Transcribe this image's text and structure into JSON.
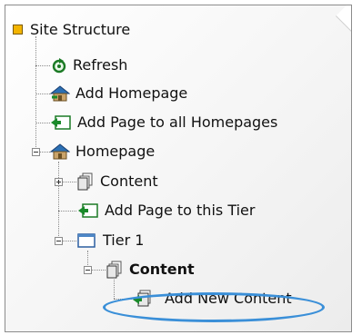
{
  "tree": {
    "root_label": "Site Structure",
    "items": [
      {
        "label": "Refresh",
        "icon": "refresh-icon"
      },
      {
        "label": "Add Homepage",
        "icon": "add-homepage-icon"
      },
      {
        "label": "Add Page to all Homepages",
        "icon": "add-page-icon"
      },
      {
        "label": "Homepage",
        "icon": "homepage-icon"
      },
      {
        "label": "Content",
        "icon": "content-pages-icon"
      },
      {
        "label": "Add Page to this Tier",
        "icon": "add-page-icon"
      },
      {
        "label": "Tier 1",
        "icon": "tier-icon"
      },
      {
        "label": "Content",
        "icon": "content-pages-icon"
      },
      {
        "label": "Add New Content",
        "icon": "add-content-icon"
      }
    ]
  },
  "colors": {
    "root_bullet": "#f3b400",
    "highlight": "#3a8fd8",
    "add_icon": "#1a8a2a",
    "house_roof": "#2b6fb3"
  }
}
